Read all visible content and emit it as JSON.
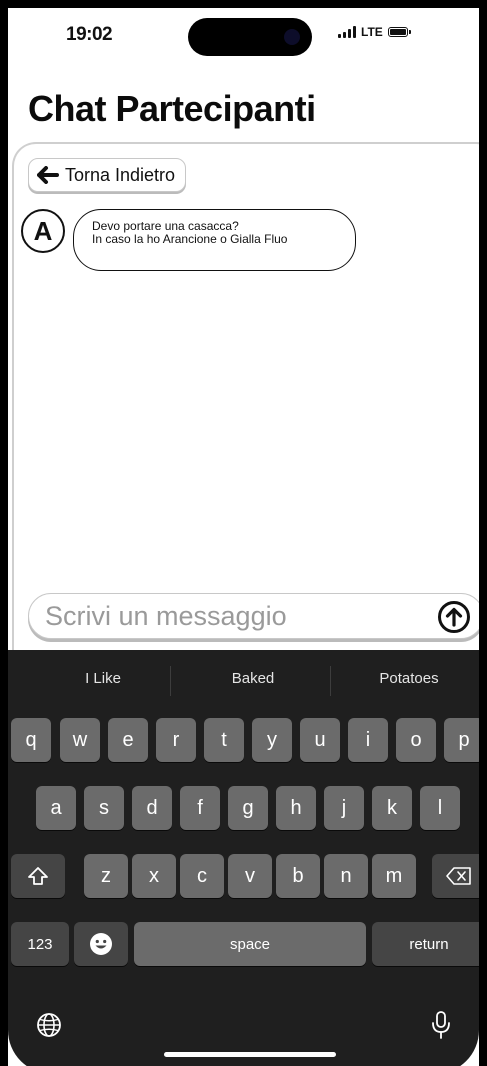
{
  "status_bar": {
    "time": "19:02",
    "network": "LTE"
  },
  "page": {
    "title": "Chat Partecipanti"
  },
  "back_button": {
    "label": "Torna Indietro"
  },
  "messages": [
    {
      "avatar": "A",
      "lines": [
        "Devo portare una casacca?",
        "In caso la ho Arancione o Gialla Fluo"
      ]
    }
  ],
  "composer": {
    "placeholder": "Scrivi un messaggio",
    "value": ""
  },
  "keyboard": {
    "suggestions": [
      "I Like",
      "Baked",
      "Potatoes"
    ],
    "row1": [
      "q",
      "w",
      "e",
      "r",
      "t",
      "y",
      "u",
      "i",
      "o",
      "p"
    ],
    "row2": [
      "a",
      "s",
      "d",
      "f",
      "g",
      "h",
      "j",
      "k",
      "l"
    ],
    "row3": [
      "z",
      "x",
      "c",
      "v",
      "b",
      "n",
      "m"
    ],
    "numbers_key": "123",
    "space_key": "space",
    "return_key": "return"
  },
  "icons": [
    "back-arrow-icon",
    "send-arrow-icon",
    "shift-icon",
    "delete-icon",
    "emoji-icon",
    "globe-icon",
    "microphone-icon",
    "battery-icon",
    "signal-icon"
  ]
}
